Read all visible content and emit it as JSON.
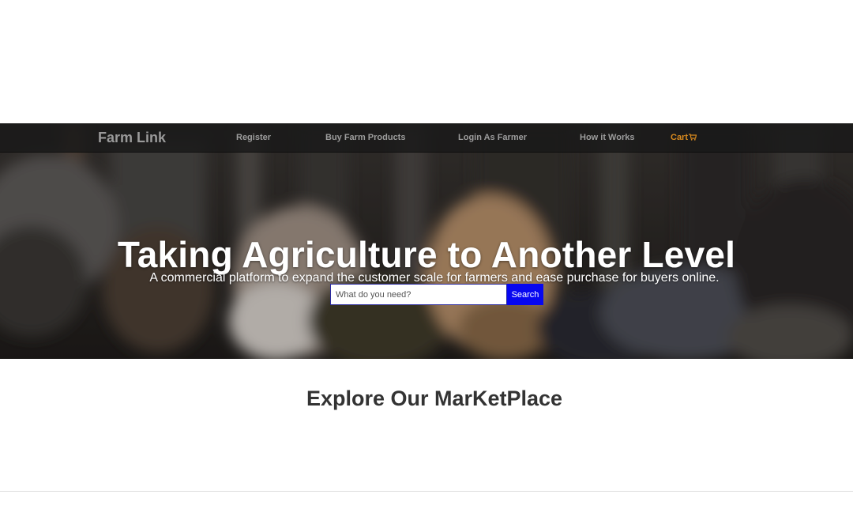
{
  "nav": {
    "brand": "Farm Link",
    "links": [
      {
        "label": "Register"
      },
      {
        "label": "Buy Farm Products"
      },
      {
        "label": "Login As Farmer"
      },
      {
        "label": "How it Works"
      }
    ],
    "cart_label": "Cart",
    "cart_icon": "shopping-cart-icon"
  },
  "hero": {
    "background": "blurred photo of chickens in a barn",
    "title": "Taking Agriculture to Another Level",
    "subtitle": "A commercial platform to expand the customer scale for farmers and ease purchase for buyers online."
  },
  "search": {
    "placeholder": "What do you need?",
    "value": "",
    "button_label": "Search"
  },
  "marketplace": {
    "title": "Explore Our MarKetPlace"
  },
  "colors": {
    "nav_background": "#1e1e1e",
    "nav_text": "#9d9d9d",
    "cart_accent": "#d98a1e",
    "search_button": "#0707f0",
    "heading_text": "#333333"
  }
}
